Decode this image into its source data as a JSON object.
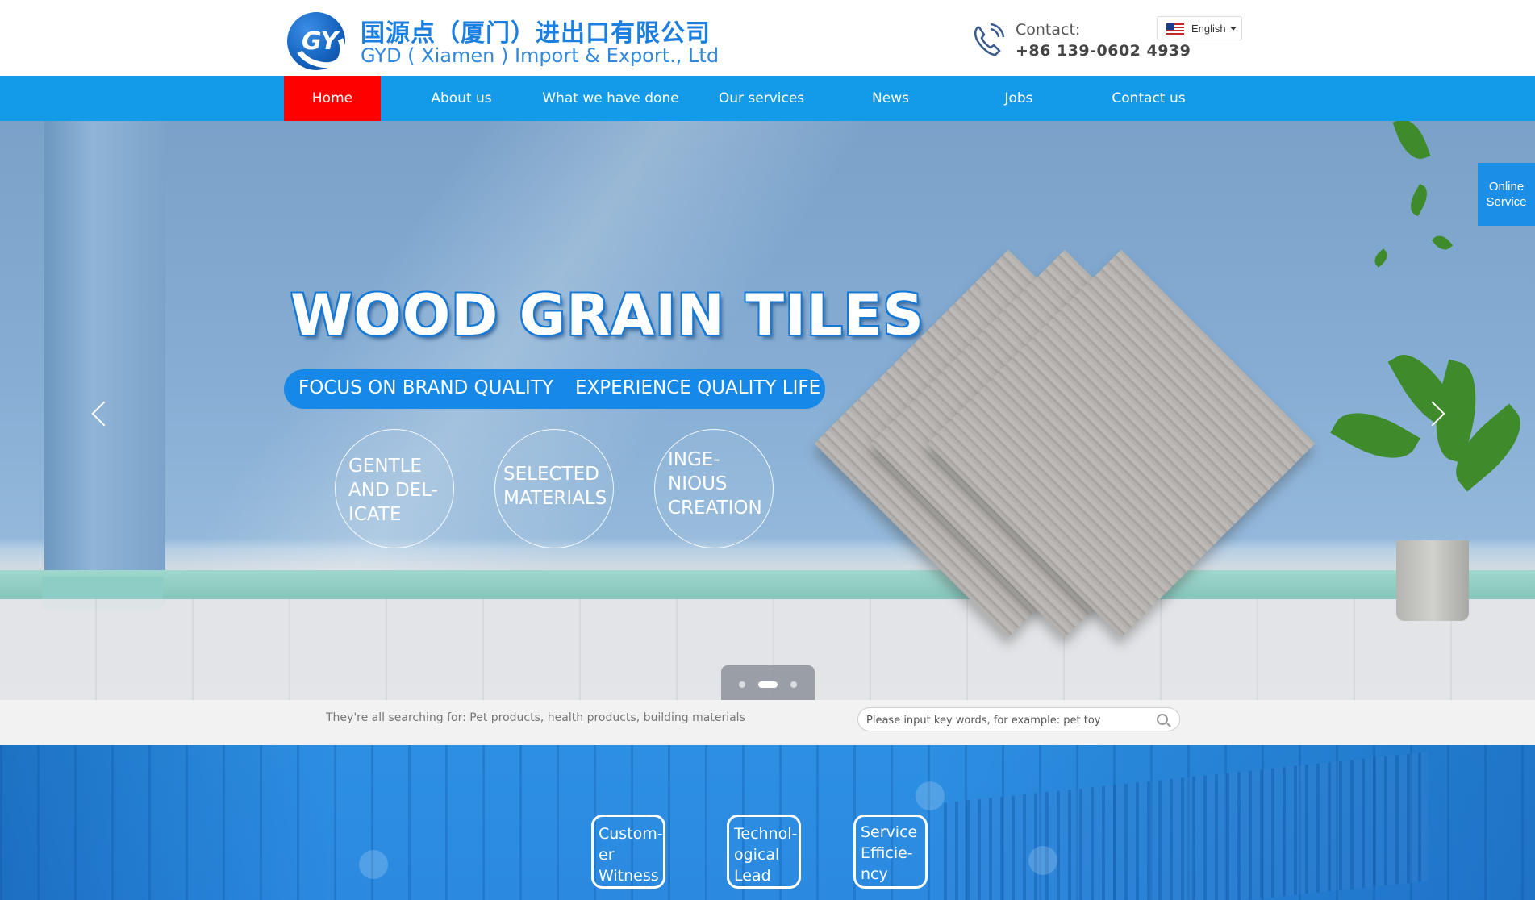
{
  "header": {
    "logo_letters": "GY",
    "company_name_cn": "国源点（厦门）进出口有限公司",
    "company_name_en": "GYD ( Xiamen ) Import & Export., Ltd",
    "contact_label": "Contact:",
    "contact_phone": "+86 139-0602 4939",
    "language": {
      "selected": "English",
      "icon": "us-flag-icon"
    }
  },
  "nav": {
    "items": [
      {
        "label": "Home",
        "active": true
      },
      {
        "label": "About us",
        "active": false
      },
      {
        "label": "What we have done",
        "active": false
      },
      {
        "label": "Our services",
        "active": false
      },
      {
        "label": "News",
        "active": false
      },
      {
        "label": "Jobs",
        "active": false
      },
      {
        "label": "Contact us",
        "active": false
      }
    ],
    "bg_color": "#139be9",
    "active_color": "#ff0000"
  },
  "banner": {
    "title": "WOOD GRAIN TILES",
    "tagline_a": "FOCUS ON BRAND QUALITY",
    "tagline_b": "EXPERIENCE QUALITY LIFE",
    "circles": [
      {
        "lines": [
          "GENTLE",
          "AND DEL-",
          "ICATE"
        ]
      },
      {
        "lines": [
          "SELECTED",
          "MATERIALS"
        ]
      },
      {
        "lines": [
          "INGE-",
          "NIOUS",
          "CREATION"
        ]
      }
    ],
    "slides_count": 3,
    "active_slide": 2,
    "prev_icon": "chevron-left-icon",
    "next_icon": "chevron-right-icon"
  },
  "online_service": {
    "line1": "Online",
    "line2": "Service"
  },
  "search": {
    "hint": "They're all searching for: Pet products, health products, building materials",
    "placeholder": "Please input key words, for example: pet toy",
    "icon": "search-icon"
  },
  "features": {
    "items": [
      {
        "lines": [
          "Custom-",
          "er",
          "Witness"
        ]
      },
      {
        "lines": [
          "Technol-",
          "ogical",
          "Lead"
        ]
      },
      {
        "lines": [
          "Service",
          "Efficie-",
          "ncy"
        ]
      }
    ],
    "bg_color": "#2b8ae0"
  }
}
